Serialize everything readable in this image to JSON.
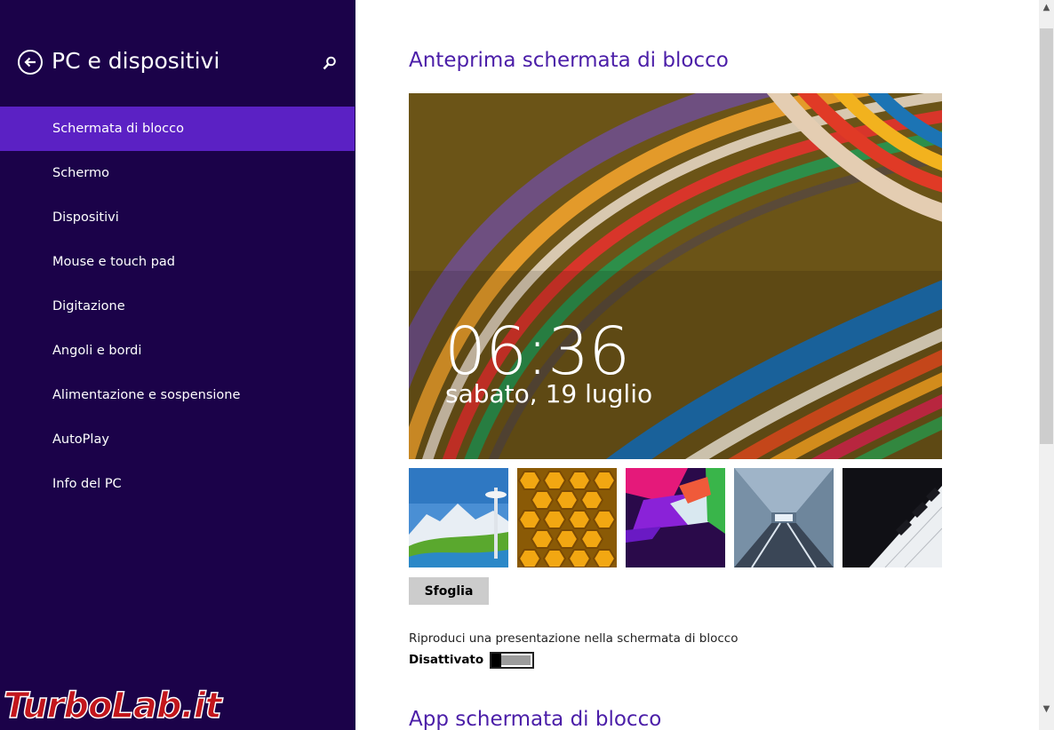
{
  "sidebar": {
    "title": "PC e dispositivi",
    "back_icon": "back-arrow-icon",
    "search_icon": "search-icon",
    "items": [
      {
        "label": "Schermata di blocco",
        "selected": true
      },
      {
        "label": "Schermo"
      },
      {
        "label": "Dispositivi"
      },
      {
        "label": "Mouse e touch pad"
      },
      {
        "label": "Digitazione"
      },
      {
        "label": "Angoli e bordi"
      },
      {
        "label": "Alimentazione e sospensione"
      },
      {
        "label": "AutoPlay"
      },
      {
        "label": "Info del PC"
      }
    ],
    "watermark": "TurboLab.it"
  },
  "main": {
    "title": "Anteprima schermata di blocco",
    "preview": {
      "time": "06:36",
      "date": "sabato, 19 luglio"
    },
    "thumbnails": [
      "space-needle-thumbnail",
      "honeycomb-thumbnail",
      "color-prism-thumbnail",
      "tunnel-thumbnail",
      "piano-keys-thumbnail"
    ],
    "browse_label": "Sfoglia",
    "slideshow": {
      "label": "Riproduci una presentazione nella schermata di blocco",
      "state": "Disattivato",
      "on": false
    },
    "section2_title": "App schermata di blocco"
  },
  "colors": {
    "sidebar_bg": "#1b0249",
    "selected_bg": "#5b21c4",
    "accent": "#4b1ea8",
    "watermark": "#c2161c"
  }
}
